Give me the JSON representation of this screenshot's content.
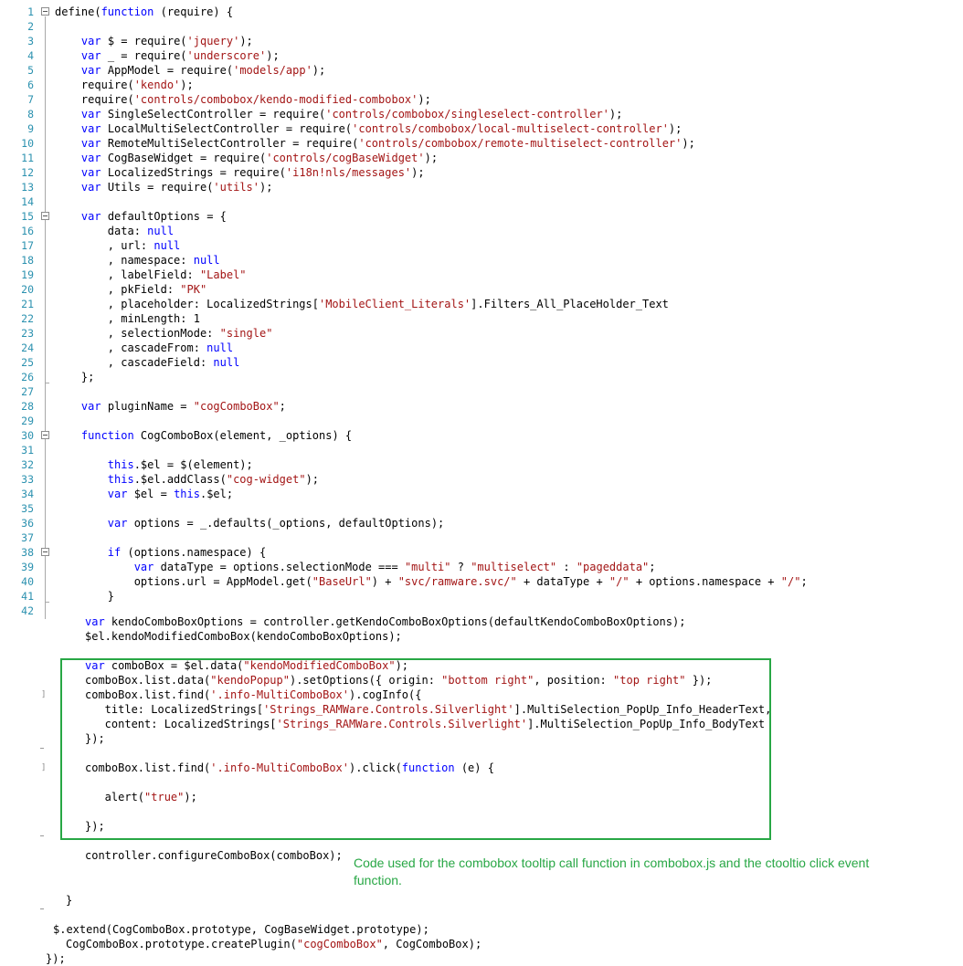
{
  "editor": {
    "line_numbers": [
      "1",
      "2",
      "3",
      "4",
      "5",
      "6",
      "7",
      "8",
      "9",
      "10",
      "11",
      "12",
      "13",
      "14",
      "15",
      "16",
      "17",
      "18",
      "19",
      "20",
      "21",
      "22",
      "23",
      "24",
      "25",
      "26",
      "27",
      "28",
      "29",
      "30",
      "31",
      "32",
      "33",
      "34",
      "35",
      "36",
      "37",
      "38",
      "39",
      "40",
      "41",
      "42"
    ],
    "lines": [
      "define(function (require) {",
      "",
      "    var $ = require('jquery');",
      "    var _ = require('underscore');",
      "    var AppModel = require('models/app');",
      "    require('kendo');",
      "    require('controls/combobox/kendo-modified-combobox');",
      "    var SingleSelectController = require('controls/combobox/singleselect-controller');",
      "    var LocalMultiSelectController = require('controls/combobox/local-multiselect-controller');",
      "    var RemoteMultiSelectController = require('controls/combobox/remote-multiselect-controller');",
      "    var CogBaseWidget = require('controls/cogBaseWidget');",
      "    var LocalizedStrings = require('i18n!nls/messages');",
      "    var Utils = require('utils');",
      "",
      "    var defaultOptions = {",
      "        data: null",
      "        , url: null",
      "        , namespace: null",
      "        , labelField: \"Label\"",
      "        , pkField: \"PK\"",
      "        , placeholder: LocalizedStrings['MobileClient_Literals'].Filters_All_PlaceHolder_Text",
      "        , minLength: 1",
      "        , selectionMode: \"single\"",
      "        , cascadeFrom: null",
      "        , cascadeField: null",
      "    };",
      "",
      "    var pluginName = \"cogComboBox\";",
      "",
      "    function CogComboBox(element, _options) {",
      "",
      "        this.$el = $(element);",
      "        this.$el.addClass(\"cog-widget\");",
      "        var $el = this.$el;",
      "",
      "        var options = _.defaults(_options, defaultOptions);",
      "",
      "        if (options.namespace) {",
      "            var dataType = options.selectionMode === \"multi\" ? \"multiselect\" : \"pageddata\";",
      "            options.url = AppModel.get(\"BaseUrl\") + \"svc/ramware.svc/\" + dataType + \"/\" + options.namespace + \"/\";",
      "        }",
      ""
    ],
    "continuation_lines": [
      "var kendoComboBoxOptions = controller.getKendoComboBoxOptions(defaultKendoComboBoxOptions);",
      "$el.kendoModifiedComboBox(kendoComboBoxOptions);",
      "",
      "var comboBox = $el.data(\"kendoModifiedComboBox\");",
      "comboBox.list.data(\"kendoPopup\").setOptions({ origin: \"bottom right\", position: \"top right\" });",
      "comboBox.list.find('.info-MultiComboBox').cogInfo({",
      "   title: LocalizedStrings['Strings_RAMWare.Controls.Silverlight'].MultiSelection_PopUp_Info_HeaderText,",
      "   content: LocalizedStrings['Strings_RAMWare.Controls.Silverlight'].MultiSelection_PopUp_Info_BodyText",
      "});",
      "",
      "comboBox.list.find('.info-MultiComboBox').click(function (e) {",
      "",
      "   alert(\"true\");",
      "",
      "});",
      "",
      "controller.configureComboBox(comboBox);",
      "",
      "",
      "}",
      "",
      "$.extend(CogComboBox.prototype, CogBaseWidget.prototype);",
      "CogComboBox.prototype.createPlugin(\"cogComboBox\", CogComboBox);",
      "});"
    ]
  },
  "annotation": {
    "text": "Code used for the combobox tooltip call function in combobox.js and the ctooltio click event function."
  },
  "colors": {
    "keyword": "#0000ff",
    "string": "#a31515",
    "line_number": "#2b91af",
    "highlight_border": "#28a745",
    "annotation": "#28a745"
  }
}
